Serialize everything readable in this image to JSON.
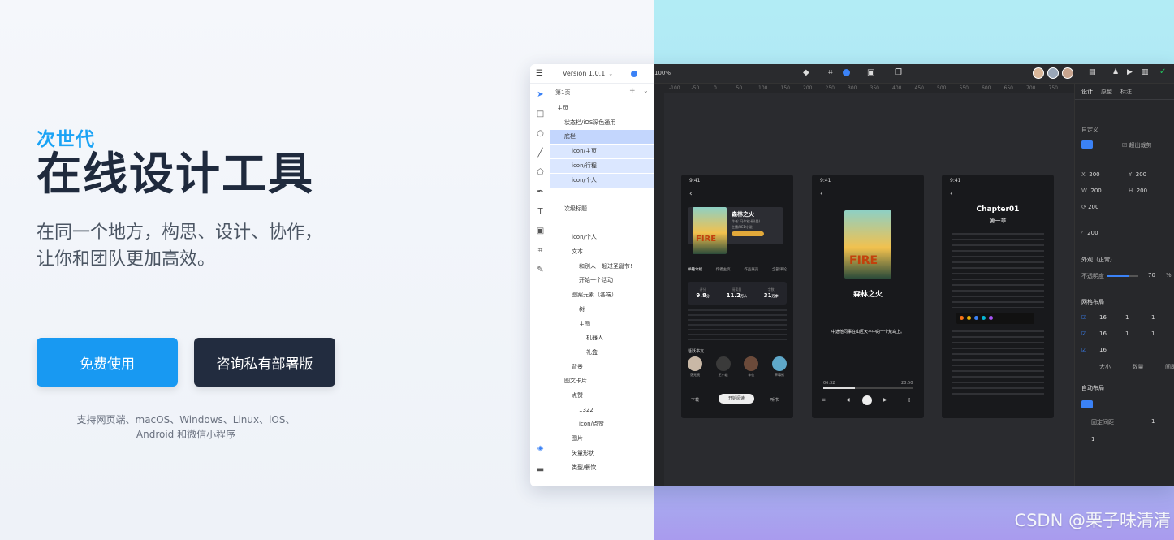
{
  "hero": {
    "subtitle": "次世代",
    "title": "在线设计工具",
    "desc_line1": "在同一个地方，构思、设计、协作，",
    "desc_line2": "让你和团队更加高效。",
    "btn_primary": "免费使用",
    "btn_secondary": "咨询私有部署版",
    "platforms_line1": "支持网页端、macOS、Windows、Linux、iOS、",
    "platforms_line2": "Android 和微信小程序"
  },
  "watermark": "CSDN @栗子味清清",
  "app": {
    "version": "Version 1.0.1",
    "page_label": "第1页",
    "zoom": "100%",
    "layers": [
      {
        "label": "主页",
        "indent": 0,
        "state": "none"
      },
      {
        "label": "状态栏/iOS深色通用",
        "indent": 1,
        "state": "none"
      },
      {
        "label": "底栏",
        "indent": 1,
        "state": "sel2"
      },
      {
        "label": "icon/主页",
        "indent": 2,
        "state": "sel"
      },
      {
        "label": "icon/行程",
        "indent": 2,
        "state": "sel"
      },
      {
        "label": "icon/个人",
        "indent": 2,
        "state": "sel"
      },
      {
        "label": "",
        "indent": 1,
        "state": "none"
      },
      {
        "label": "次级标题",
        "indent": 1,
        "state": "none"
      },
      {
        "label": "",
        "indent": 1,
        "state": "none"
      },
      {
        "label": "icon/个人",
        "indent": 2,
        "state": "none"
      },
      {
        "label": "文本",
        "indent": 2,
        "state": "none"
      },
      {
        "label": "和别人一起过圣诞节!",
        "indent": 3,
        "state": "none"
      },
      {
        "label": "开始一个活动",
        "indent": 3,
        "state": "none"
      },
      {
        "label": "图案元素（各端）",
        "indent": 2,
        "state": "none"
      },
      {
        "label": "树",
        "indent": 3,
        "state": "none"
      },
      {
        "label": "主图",
        "indent": 3,
        "state": "none"
      },
      {
        "label": "机器人",
        "indent": 4,
        "state": "none"
      },
      {
        "label": "礼盒",
        "indent": 4,
        "state": "none"
      },
      {
        "label": "背景",
        "indent": 2,
        "state": "none"
      },
      {
        "label": "图文卡片",
        "indent": 1,
        "state": "none"
      },
      {
        "label": "点赞",
        "indent": 2,
        "state": "none"
      },
      {
        "label": "1322",
        "indent": 3,
        "state": "none"
      },
      {
        "label": "icon/点赞",
        "indent": 3,
        "state": "none"
      },
      {
        "label": "图片",
        "indent": 2,
        "state": "none"
      },
      {
        "label": "矢量形状",
        "indent": 2,
        "state": "none"
      },
      {
        "label": "类型/餐饮",
        "indent": 2,
        "state": "none"
      }
    ],
    "ruler": [
      "-100",
      "-50",
      "0",
      "50",
      "100",
      "150",
      "200",
      "250",
      "300",
      "350",
      "400",
      "450",
      "500",
      "550",
      "600",
      "650",
      "700",
      "750"
    ],
    "phone1": {
      "time": "9:41",
      "book_title": "森林之火",
      "book_meta1": "作者: 马尔钦·德(美)",
      "book_meta2": "主播/RED小说",
      "tabs": [
        "书籍介绍",
        "作者主页",
        "作品展览",
        "全部评论"
      ],
      "stats": [
        {
          "label": "评分",
          "value": "9.8",
          "unit": "分"
        },
        {
          "label": "阅读量",
          "value": "11.2",
          "unit": "万人"
        },
        {
          "label": "字数",
          "value": "31",
          "unit": "万字"
        }
      ],
      "section": "活跃书友",
      "friends": [
        "落无痕",
        "王小姐",
        "李佳",
        "草莓熊"
      ],
      "download": "下载",
      "read_btn": "开始阅读",
      "listen": "听书"
    },
    "phone2": {
      "time": "9:41",
      "book_title": "森林之火",
      "time_start": "06:32",
      "time_end": "28:50",
      "highlight": "中途他同事在山区天平中的一个荒岛上。"
    },
    "phone3": {
      "time": "9:41",
      "chapter": "Chapter01",
      "chapter_cn": "第一章"
    },
    "props": {
      "tabs": [
        "设计",
        "原型",
        "标注"
      ],
      "mode": "自定义",
      "clip": "超出裁剪",
      "x": "200",
      "y": "200",
      "w": "200",
      "h": "200",
      "rot": "200",
      "radius": "200",
      "appearance": "外观（正常）",
      "opacity_label": "不透明度",
      "opacity": "70",
      "opacity_unit": "%",
      "grid": "网格布局",
      "grid_rows": [
        [
          "16",
          "1",
          "1"
        ],
        [
          "16",
          "1",
          "1"
        ],
        [
          "16"
        ]
      ],
      "grid_cols": [
        "大小",
        "数量",
        "间距"
      ],
      "auto": "自动布局",
      "gap": "固定间距",
      "gap_val": "1",
      "pad": "1"
    }
  },
  "colors": {
    "accent": "#1899f2",
    "dark_btn": "#222c3f",
    "title": "#1f2a3d"
  }
}
